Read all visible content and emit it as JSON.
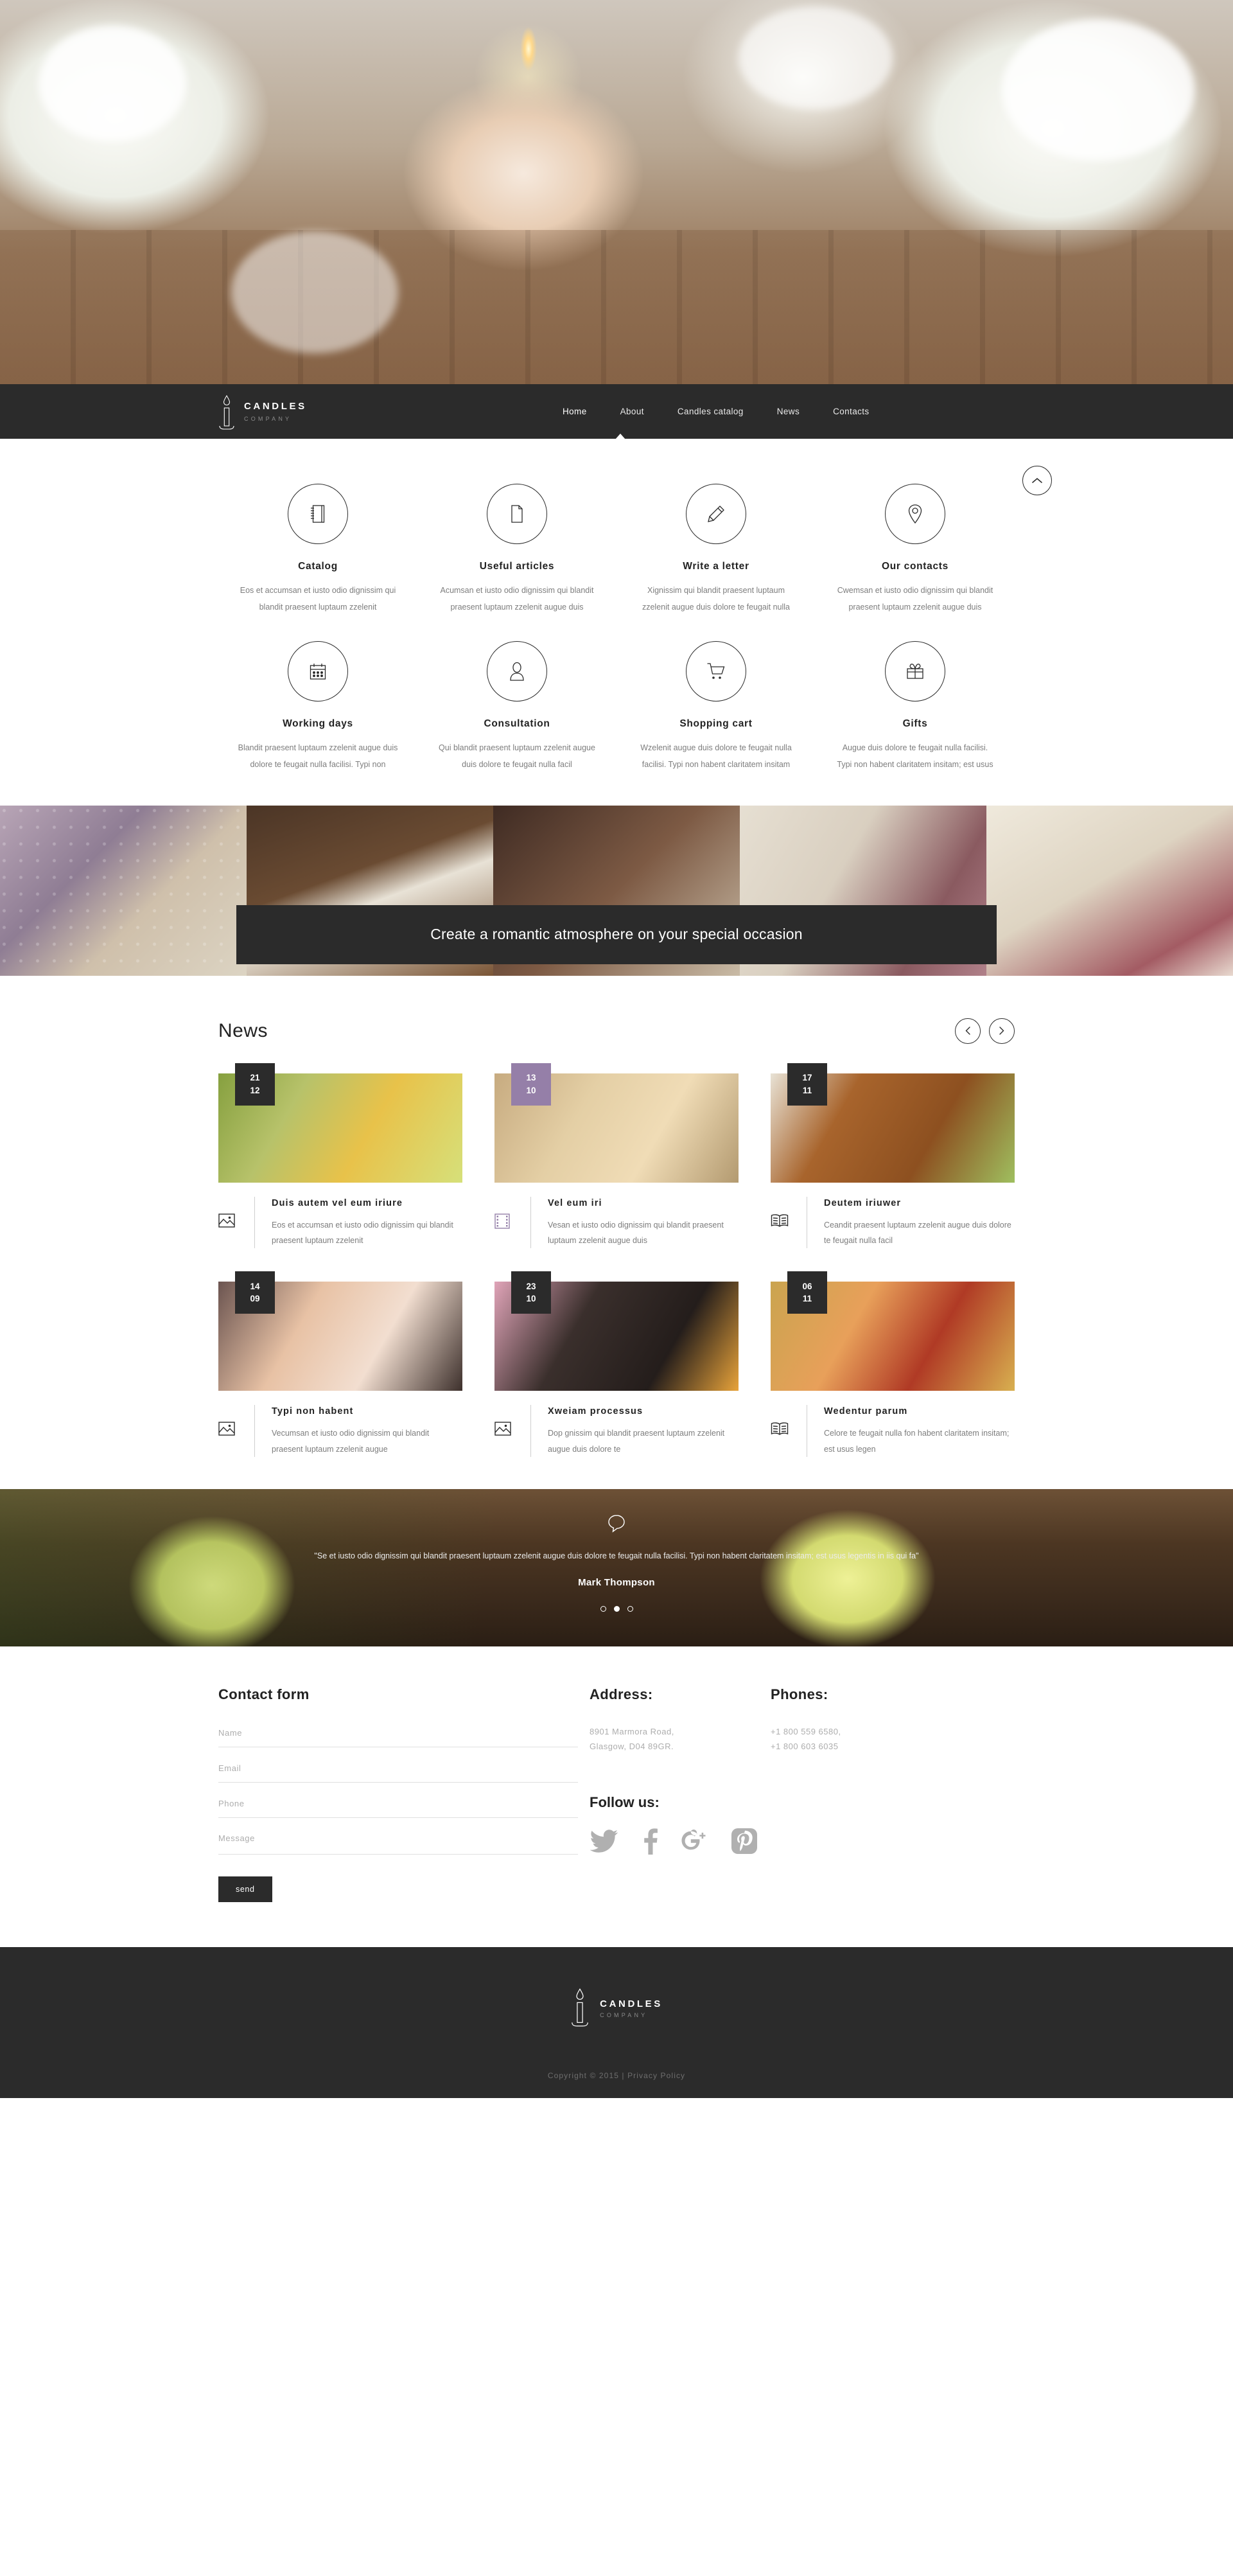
{
  "brand": {
    "name": "CANDLES",
    "sub": "COMPANY",
    "logo_icon": "candle-icon"
  },
  "nav": {
    "items": [
      {
        "label": "Home",
        "active": true
      },
      {
        "label": "About",
        "active": false
      },
      {
        "label": "Candles catalog",
        "active": false
      },
      {
        "label": "News",
        "active": false
      },
      {
        "label": "Contacts",
        "active": false
      }
    ],
    "scroll_top_icon": "chevron-up-icon"
  },
  "features": [
    {
      "icon": "notebook-icon",
      "title": "Catalog",
      "desc": "Eos et accumsan et iusto odio dignissim qui blandit praesent luptaum zzelenit"
    },
    {
      "icon": "document-icon",
      "title": "Useful articles",
      "desc": "Acumsan et iusto odio dignissim qui blandit praesent luptaum zzelenit augue duis"
    },
    {
      "icon": "pencil-icon",
      "title": "Write a letter",
      "desc": "Xignissim qui blandit praesent luptaum zzelenit augue duis dolore te feugait nulla"
    },
    {
      "icon": "map-pin-icon",
      "title": "Our contacts",
      "desc": "Cwemsan et iusto odio dignissim qui blandit praesent luptaum zzelenit augue duis"
    },
    {
      "icon": "calendar-icon",
      "title": "Working days",
      "desc": "Blandit praesent luptaum zzelenit augue duis dolore te feugait nulla facilisi. Typi non"
    },
    {
      "icon": "user-icon",
      "title": "Consultation",
      "desc": "Qui blandit praesent luptaum zzelenit augue duis dolore te feugait nulla facil"
    },
    {
      "icon": "shopping-cart-icon",
      "title": "Shopping cart",
      "desc": "Wzelenit augue duis dolore te feugait nulla facilisi. Typi non habent claritatem insitam"
    },
    {
      "icon": "gift-icon",
      "title": "Gifts",
      "desc": "Augue duis dolore te feugait nulla facilisi. Typi non habent claritatem insitam; est usus"
    }
  ],
  "strip": {
    "banner_text": "Create a romantic atmosphere on your special occasion"
  },
  "news": {
    "title": "News",
    "prev_icon": "chevron-left-icon",
    "next_icon": "chevron-right-icon",
    "items": [
      {
        "day": "21",
        "month": "12",
        "date_accent": "dark",
        "icon": "image-icon",
        "title": "Duis autem vel eum iriure",
        "desc": "Eos et accumsan et iusto odio dignissim qui blandit praesent luptaum zzelenit"
      },
      {
        "day": "13",
        "month": "10",
        "date_accent": "purple",
        "icon": "film-icon",
        "title": "Vel eum iri",
        "desc": "Vesan et iusto odio dignissim qui blandit praesent luptaum zzelenit augue duis"
      },
      {
        "day": "17",
        "month": "11",
        "date_accent": "dark",
        "icon": "book-icon",
        "title": "Deutem iriuwer",
        "desc": "Ceandit praesent luptaum zzelenit augue duis dolore te feugait nulla facil"
      },
      {
        "day": "14",
        "month": "09",
        "date_accent": "dark",
        "icon": "image-icon",
        "title": "Typi non habent",
        "desc": "Vecumsan et iusto odio dignissim qui blandit praesent luptaum zzelenit augue"
      },
      {
        "day": "23",
        "month": "10",
        "date_accent": "dark",
        "icon": "image-icon",
        "title": "Xweiam processus",
        "desc": "Dop gnissim qui blandit praesent luptaum zzelenit augue duis dolore te"
      },
      {
        "day": "06",
        "month": "11",
        "date_accent": "dark",
        "icon": "book-icon",
        "title": "Wedentur parum",
        "desc": "Celore te feugait nulla fon habent claritatem insitam; est usus legen"
      }
    ]
  },
  "testimonial": {
    "quote_icon": "speech-bubble-icon",
    "text": "\"Se et iusto odio dignissim qui blandit praesent luptaum zzelenit augue duis dolore te feugait nulla facilisi. Typi non habent claritatem insitam; est usus legentis in iis qui fa\"",
    "author": "Mark Thompson",
    "dots": 3,
    "active_dot": 1
  },
  "contact": {
    "form_title": "Contact form",
    "fields": [
      {
        "name": "name",
        "placeholder": "Name",
        "value": ""
      },
      {
        "name": "email",
        "placeholder": "Email",
        "value": ""
      },
      {
        "name": "phone",
        "placeholder": "Phone",
        "value": ""
      },
      {
        "name": "message",
        "placeholder": "Message",
        "value": ""
      }
    ],
    "send_label": "send",
    "address_title": "Address:",
    "address_line1": "8901 Marmora Road,",
    "address_line2": "Glasgow, D04 89GR.",
    "phones_title": "Phones:",
    "phone1": "+1 800 559 6580,",
    "phone2": "+1 800 603 6035",
    "follow_title": "Follow us:",
    "socials": [
      {
        "icon": "twitter-icon",
        "name": "Twitter"
      },
      {
        "icon": "facebook-icon",
        "name": "Facebook"
      },
      {
        "icon": "google-plus-icon",
        "name": "Google Plus"
      },
      {
        "icon": "pinterest-icon",
        "name": "Pinterest"
      }
    ]
  },
  "footer": {
    "brand_name": "CANDLES",
    "brand_sub": "COMPANY",
    "copyright": "Copyright © 2015 | Privacy Policy"
  },
  "colors": {
    "dark": "#2b2b2b",
    "purple_accent": "#957fa8",
    "muted_text": "#7d7d7d",
    "placeholder": "#adadad",
    "social_gray": "#b0b0b0"
  }
}
